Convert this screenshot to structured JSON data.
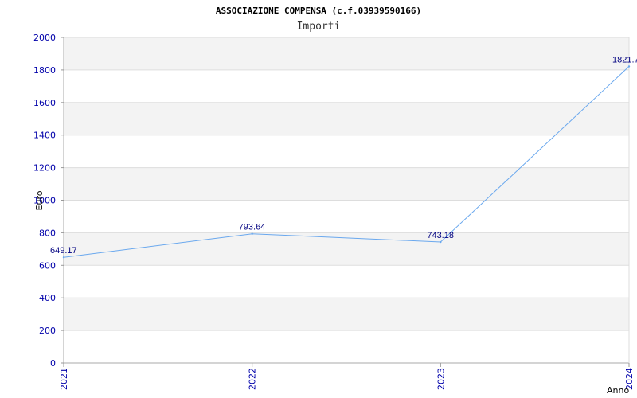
{
  "chart_data": {
    "type": "line",
    "title": "ASSOCIAZIONE COMPENSA (c.f.03939590166)",
    "subtitle": "Importi",
    "xlabel": "Anno",
    "ylabel": "Euro",
    "categories": [
      "2021",
      "2022",
      "2023",
      "2024"
    ],
    "series": [
      {
        "values": [
          649.17,
          793.64,
          743.18,
          1821.7
        ]
      }
    ],
    "data_labels": [
      "649.17",
      "793.64",
      "743.18",
      "1821.7"
    ],
    "ylim": [
      0,
      2000
    ],
    "yticks": [
      "0",
      "200",
      "400",
      "600",
      "800",
      "1000",
      "1200",
      "1400",
      "1600",
      "1800",
      "2000"
    ],
    "grid": true,
    "band_color": "#f3f3f3",
    "line_color": "#6aa8ee",
    "tick_color": "#0000aa"
  }
}
